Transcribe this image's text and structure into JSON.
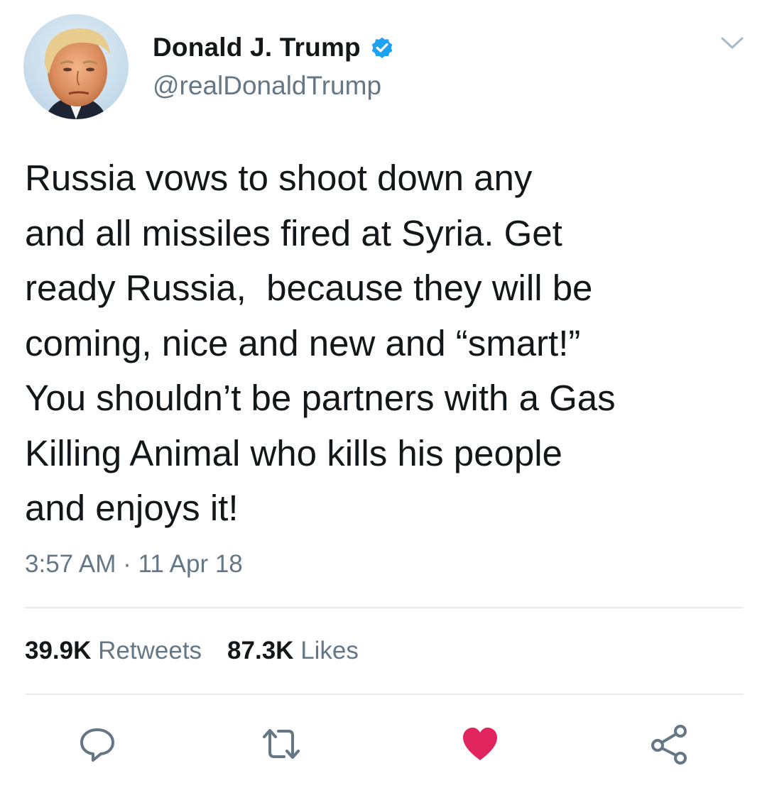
{
  "author": {
    "display_name": "Donald J. Trump",
    "handle": "@realDonaldTrump",
    "verified": true
  },
  "tweet": {
    "lines": [
      "Russia vows to shoot down any",
      "and all missiles fired at Syria. Get",
      "ready Russia,  because they will be",
      "coming, nice and new and “smart!”",
      "You shouldn’t be partners with a Gas",
      "Killing Animal who kills his people",
      "and enjoys it!"
    ],
    "timestamp": "3:57 AM · 11 Apr 18"
  },
  "stats": {
    "retweets_count": "39.9K",
    "retweets_label": "Retweets",
    "likes_count": "87.3K",
    "likes_label": "Likes"
  },
  "actions": {
    "reply_icon": "reply-icon",
    "retweet_icon": "retweet-icon",
    "like_icon": "heart-icon",
    "share_icon": "share-icon",
    "liked": true
  },
  "colors": {
    "verified_blue": "#1da1f2",
    "like_red": "#e0245e",
    "secondary_text": "#657786",
    "icon_gray": "#657786",
    "divider": "#e6ecf0"
  }
}
